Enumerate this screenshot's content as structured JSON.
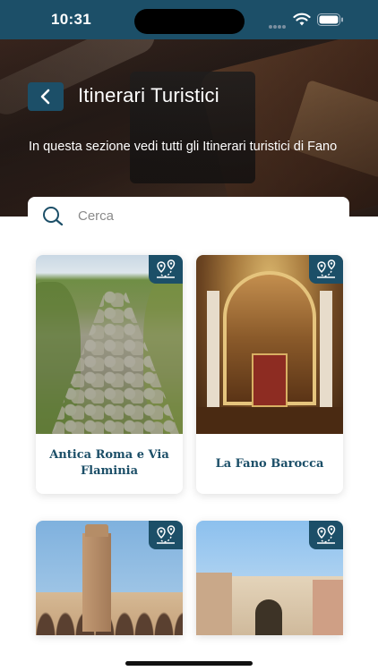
{
  "status_bar": {
    "time": "10:31"
  },
  "header": {
    "title": "Itinerari Turistici",
    "subtitle": "In questa sezione vedi tutti gli Itinerari turistici di Fano",
    "back_icon": "chevron-left-icon",
    "background_image": "leather-bag-photo"
  },
  "search": {
    "placeholder": "Cerca",
    "icon": "search-icon"
  },
  "itineraries": [
    {
      "label": "Antica Roma e Via Flaminia",
      "image": "roman-road-photo",
      "badge_icon": "route-pins-icon"
    },
    {
      "label": "La Fano Barocca",
      "image": "baroque-church-interior-photo",
      "badge_icon": "route-pins-icon"
    },
    {
      "label": "",
      "image": "bell-tower-cloister-photo",
      "badge_icon": "route-pins-icon"
    },
    {
      "label": "",
      "image": "city-gate-photo",
      "badge_icon": "route-pins-icon"
    }
  ],
  "colors": {
    "primary": "#1c4f68",
    "text_on_dark": "#ffffff",
    "card_label": "#1c4f68"
  }
}
